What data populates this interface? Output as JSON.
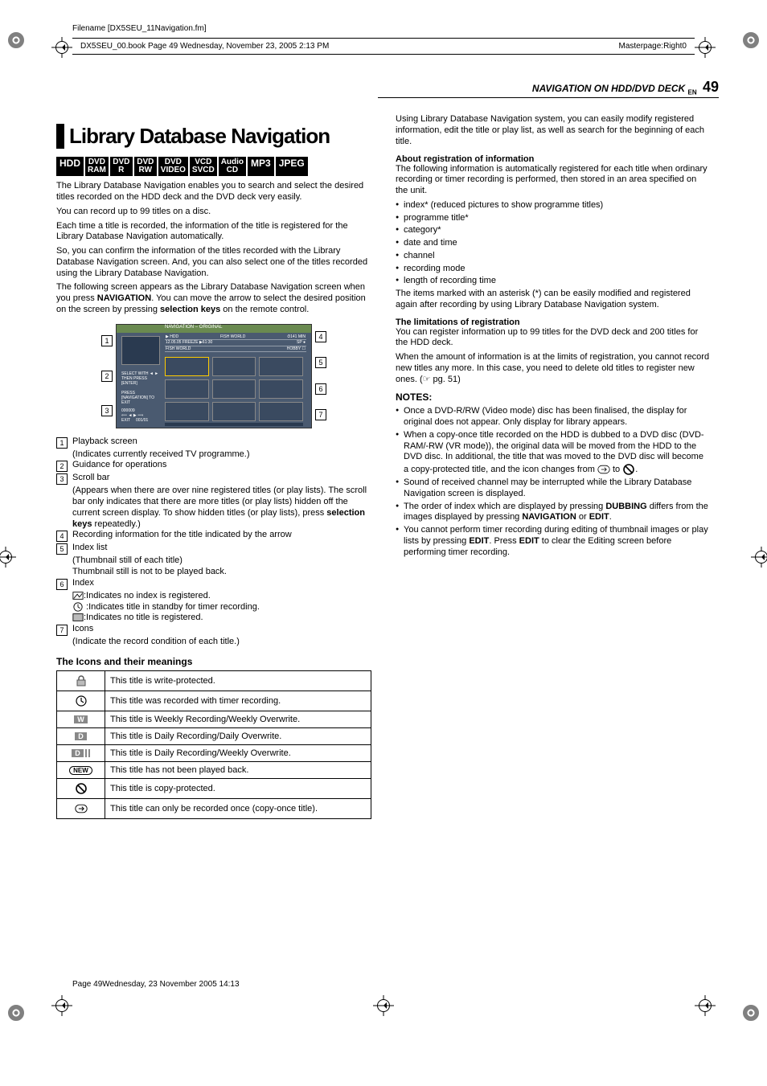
{
  "meta": {
    "filename_label": "Filename [DX5SEU_11Navigation.fm]",
    "bookinfo_left": "DX5SEU_00.book  Page 49  Wednesday, November 23, 2005  2:13 PM",
    "bookinfo_right": "Masterpage:Right0",
    "footer": "Page 49Wednesday, 23 November 2005  14:13"
  },
  "header": {
    "section_title": "NAVIGATION ON HDD/DVD DECK",
    "lang": "EN",
    "page_number": "49"
  },
  "title": "Library Database Navigation",
  "badges": [
    "HDD",
    "DVD RAM",
    "DVD R",
    "DVD RW",
    "DVD VIDEO",
    "VCD SVCD",
    "Audio CD",
    "MP3",
    "JPEG"
  ],
  "intro": {
    "p1": "The Library Database Navigation enables you to search and select the desired titles recorded on the HDD deck and the DVD deck very easily.",
    "p2": "You can record up to 99 titles on a disc.",
    "p3": "Each time a title is recorded, the information of the title is registered for the Library Database Navigation automatically.",
    "p4": "So, you can confirm the information of the titles recorded with the Library Database Navigation screen. And, you can also select one of the titles recorded using the Library Database Navigation.",
    "p5a": "The following screen appears as the Library Database Navigation screen when you press ",
    "p5b": "NAVIGATION",
    "p5c": ". You can move the arrow to select the desired position on the screen by pressing ",
    "p5d": "selection keys",
    "p5e": " on the remote control."
  },
  "diagram": {
    "topbar": "NAVIGATION – ORIGINAL",
    "info_rows": [
      [
        "HDD",
        "FISH WORLD",
        "141 MIN"
      ],
      [
        "12.05.05",
        "FREEZE",
        "61:30",
        "SP"
      ],
      [
        "FISH WORLD",
        "HOBBY"
      ]
    ],
    "guide1": "SELECT WITH ◄ ► THEN PRESS [ENTER]",
    "guide2": "PRESS [NAVIGATION] TO EXIT",
    "bottom": "000009"
  },
  "legend": [
    {
      "n": "1",
      "title": "Playback screen",
      "sub": "(Indicates currently received TV programme.)"
    },
    {
      "n": "2",
      "title": "Guidance for operations",
      "sub": ""
    },
    {
      "n": "3",
      "title": "Scroll bar",
      "sub": "(Appears when there are over nine registered titles (or play lists). The scroll bar only indicates that there are more titles (or play lists) hidden off the current screen display. To show hidden titles (or play lists), press selection keys repeatedly.)"
    },
    {
      "n": "4",
      "title": "Recording information for the title indicated by the arrow",
      "sub": ""
    },
    {
      "n": "5",
      "title": "Index list",
      "sub": "(Thumbnail still of each title)\nThumbnail still is not to be played back."
    },
    {
      "n": "6",
      "title": "Index",
      "sub": ":Indicates no index is registered.\n:Indicates title in standby for timer recording.\n:Indicates no title is registered."
    },
    {
      "n": "7",
      "title": "Icons",
      "sub": "(Indicate the record condition of each title.)"
    }
  ],
  "icons_heading": "The Icons and their meanings",
  "icons_table": [
    {
      "icon": "lock",
      "text": "This title is write-protected."
    },
    {
      "icon": "clock",
      "text": "This title was recorded with timer recording."
    },
    {
      "icon": "W",
      "text": "This title is Weekly Recording/Weekly Overwrite."
    },
    {
      "icon": "D",
      "text": "This title is Daily Recording/Daily Overwrite."
    },
    {
      "icon": "DW",
      "text": "This title is Daily Recording/Weekly Overwrite."
    },
    {
      "icon": "NEW",
      "text": "This title has not been played back."
    },
    {
      "icon": "noentry",
      "text": "This title is copy-protected."
    },
    {
      "icon": "copyonce",
      "text": "This title can only be recorded once (copy-once title)."
    }
  ],
  "right": {
    "p1": "Using Library Database Navigation system, you can easily modify registered information, edit the title or play list, as well as search for the beginning of each title.",
    "h1": "About registration of information",
    "p2": "The following information is automatically registered for each title when ordinary recording or timer recording is performed, then stored in an area specified on the unit.",
    "reg_bullets": [
      "index* (reduced pictures to show programme titles)",
      "programme title*",
      "category*",
      "date and time",
      "channel",
      "recording mode",
      "length of recording time"
    ],
    "p3": "The items marked with an asterisk (*) can be easily modified and registered again after recording by using Library Database Navigation system.",
    "h2": "The limitations of registration",
    "p4": "You can register information up to 99 titles for the DVD deck and 200 titles for the HDD deck.",
    "p5": "When the amount of information is at the limits of registration, you cannot record new titles any more. In this case, you need to delete old titles to register new ones. (☞ pg. 51)",
    "notes_head": "NOTES:",
    "notes": [
      "Once a DVD-R/RW (Video mode) disc has been finalised, the display for original does not appear. Only display for library appears.",
      "When a copy-once title recorded on the HDD is dubbed to a DVD disc (DVD-RAM/-RW (VR mode)), the original data will be moved from the HDD to the DVD disc. In additional, the title that was moved to the DVD disc will become a copy-protected title, and the icon changes from ",
      "Sound of received channel may be interrupted while the Library Database Navigation screen is displayed.",
      "The order of index which are displayed by pressing DUBBING differs from the images displayed by pressing NAVIGATION or EDIT.",
      "You cannot perform timer recording during editing of thumbnail images or play lists by pressing EDIT. Press EDIT to clear the Editing screen before performing timer recording."
    ],
    "note2_tail": " to "
  }
}
